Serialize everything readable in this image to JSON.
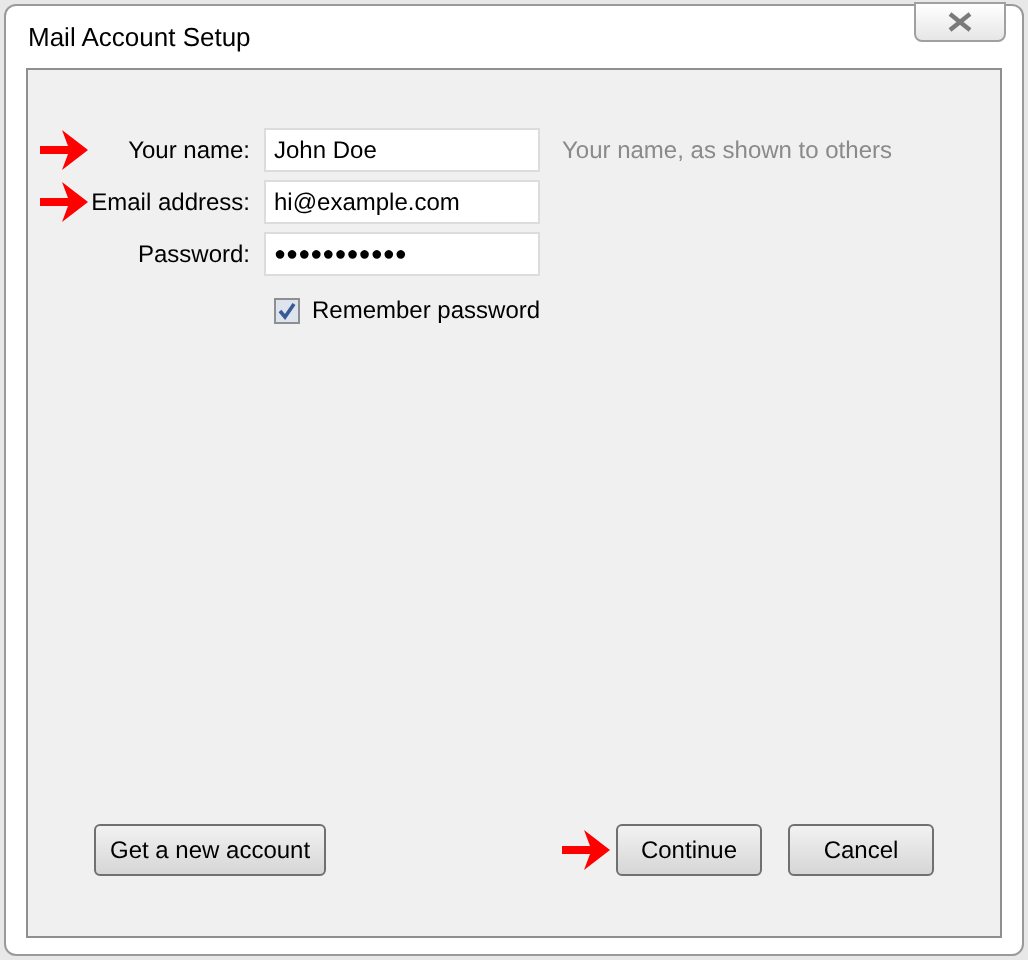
{
  "window": {
    "title": "Mail Account Setup"
  },
  "fields": [
    {
      "label": "Your name:",
      "value": "John Doe",
      "kind": "text",
      "hint": "Your name, as shown to others",
      "arrow": true
    },
    {
      "label": "Email address:",
      "value": "hi@example.com",
      "kind": "text",
      "arrow": true
    },
    {
      "label": "Password:",
      "value": "●●●●●●●●●●●",
      "kind": "password",
      "arrow": false
    }
  ],
  "remember_password": {
    "label": "Remember password",
    "checked": true
  },
  "left_buttons": [
    {
      "label": "Get a new account",
      "arrow": false
    }
  ],
  "right_buttons": [
    {
      "label": "Continue",
      "arrow": true
    },
    {
      "label": "Cancel",
      "arrow": false
    }
  ]
}
